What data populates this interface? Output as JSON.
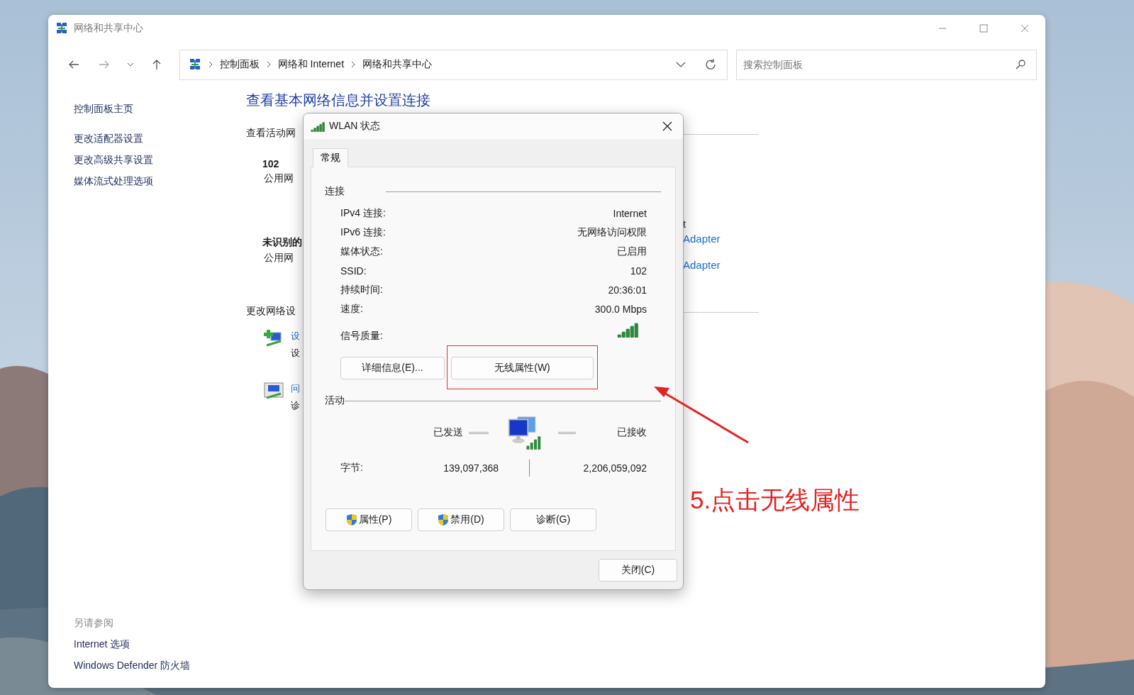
{
  "window": {
    "title": "网络和共享中心"
  },
  "address_bar": {
    "breadcrumbs": [
      "控制面板",
      "网络和 Internet",
      "网络和共享中心"
    ]
  },
  "search": {
    "placeholder": "搜索控制面板"
  },
  "sidebar": {
    "items": [
      "控制面板主页",
      "更改适配器设置",
      "更改高级共享设置",
      "媒体流式处理选项"
    ],
    "see_also": {
      "title": "另请参阅",
      "links": [
        "Internet 选项",
        "Windows Defender 防火墙"
      ]
    }
  },
  "content": {
    "heading": "查看基本网络信息并设置连接",
    "active_networks_label": "查看活动网",
    "networks": [
      {
        "name": "102",
        "type": "公用网"
      },
      {
        "name": "未识别的",
        "type": "公用网"
      }
    ],
    "access_fragments": [
      "t",
      "Adapter",
      "Adapter"
    ],
    "change_settings_label": "更改网络设",
    "tasks": [
      {
        "link": "设",
        "desc": "设"
      },
      {
        "link": "问",
        "desc": "诊"
      }
    ]
  },
  "dialog": {
    "title": "WLAN 状态",
    "tabs": [
      {
        "label": "常规",
        "selected": true
      }
    ],
    "connection": {
      "title": "连接",
      "rows": [
        {
          "label": "IPv4 连接:",
          "value": "Internet"
        },
        {
          "label": "IPv6 连接:",
          "value": "无网络访问权限"
        },
        {
          "label": "媒体状态:",
          "value": "已启用"
        },
        {
          "label": "SSID:",
          "value": "102"
        },
        {
          "label": "持续时间:",
          "value": "20:36:01"
        },
        {
          "label": "速度:",
          "value": "300.0 Mbps"
        }
      ],
      "signal_label": "信号质量:"
    },
    "buttons": [
      "详细信息(E)...",
      "无线属性(W)"
    ],
    "activity": {
      "title": "活动",
      "sent_label": "已发送",
      "received_label": "已接收",
      "bytes_label": "字节:",
      "bytes_sent": "139,097,368",
      "bytes_received": "2,206,059,092"
    },
    "action_buttons": [
      {
        "label": "属性(P)",
        "kind": "shield"
      },
      {
        "label": "禁用(D)",
        "kind": "shield"
      },
      {
        "label": "诊断(G)",
        "kind": "plain"
      }
    ],
    "close_button": "关闭(C)"
  },
  "annotation": {
    "text": "5.点击无线属性"
  }
}
